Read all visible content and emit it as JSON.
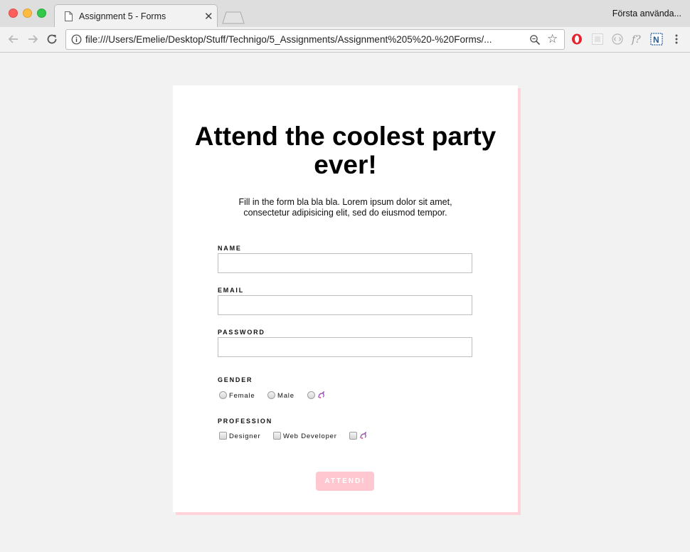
{
  "browser": {
    "tab_title": "Assignment 5 - Forms",
    "profile_name": "Första användа...",
    "url": "file:///Users/Emelie/Desktop/Stuff/Technigo/5_Assignments/Assignment%205%20-%20Forms/..."
  },
  "page": {
    "heading": "Attend the coolest party ever!",
    "intro": "Fill in the form bla bla bla. Lorem ipsum dolor sit amet, consectetur adipisicing elit, sed do eiusmod tempor.",
    "fields": {
      "name_label": "NAME",
      "email_label": "EMAIL",
      "password_label": "PASSWORD"
    },
    "gender": {
      "label": "GENDER",
      "options": [
        "Female",
        "Male"
      ]
    },
    "profession": {
      "label": "PROFESSION",
      "options": [
        "Designer",
        "Web Developer"
      ]
    },
    "submit_label": "ATTEND!"
  },
  "colors": {
    "accent_pink": "#ffc7cf",
    "card_shadow": "#ffd3d9",
    "background": "#f2f2f2"
  }
}
